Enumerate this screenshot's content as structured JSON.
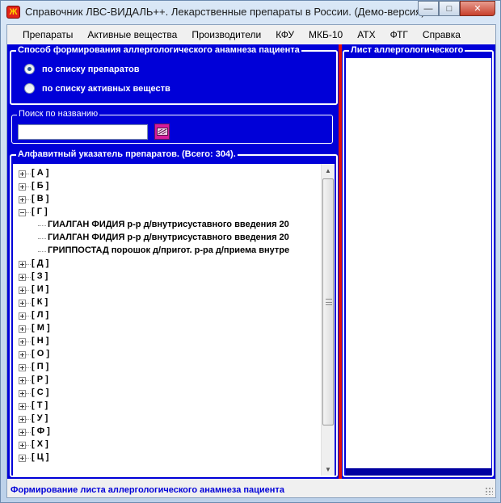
{
  "window": {
    "title": "Справочник ЛВС-ВИДАЛЬ++. Лекарственные препараты в России. (Демо-версия).",
    "app_icon": "vidal-logo-icon",
    "controls": [
      "minimize-icon",
      "maximize-icon",
      "close-icon"
    ]
  },
  "menu": {
    "items": [
      "Препараты",
      "Активные вещества",
      "Производители",
      "КФУ",
      "МКБ-10",
      "АТХ",
      "ФТГ",
      "Справка"
    ]
  },
  "mode_group": {
    "title": "Способ формирования аллергологического анамнеза пациента",
    "options": [
      {
        "label": "по списку препаратов",
        "checked": true
      },
      {
        "label": "по списку активных веществ",
        "checked": false
      }
    ]
  },
  "search": {
    "title": "Поиск по названию",
    "value": "",
    "button_icon": "find-icon"
  },
  "tree": {
    "title": "Алфавитный указатель препаратов. (Всего: 304).",
    "nodes": [
      {
        "label": "[ А ]",
        "expanded": false
      },
      {
        "label": "[ Б ]",
        "expanded": false
      },
      {
        "label": "[ В ]",
        "expanded": false
      },
      {
        "label": "[ Г ]",
        "expanded": true,
        "children": [
          "ГИАЛГАН ФИДИЯ  р-р д/внутрисуставного введения 20",
          "ГИАЛГАН ФИДИЯ  р-р д/внутрисуставного введения 20",
          "ГРИППОСТАД   порошок д/пригот. р-ра д/приема внутре"
        ]
      },
      {
        "label": "[ Д ]",
        "expanded": false
      },
      {
        "label": "[ З ]",
        "expanded": false
      },
      {
        "label": "[ И ]",
        "expanded": false
      },
      {
        "label": "[ К ]",
        "expanded": false
      },
      {
        "label": "[ Л ]",
        "expanded": false
      },
      {
        "label": "[ М ]",
        "expanded": false
      },
      {
        "label": "[ Н ]",
        "expanded": false
      },
      {
        "label": "[ О ]",
        "expanded": false
      },
      {
        "label": "[ П ]",
        "expanded": false
      },
      {
        "label": "[ Р ]",
        "expanded": false
      },
      {
        "label": "[ С ]",
        "expanded": false
      },
      {
        "label": "[ Т ]",
        "expanded": false
      },
      {
        "label": "[ У ]",
        "expanded": false
      },
      {
        "label": "[ Ф ]",
        "expanded": false
      },
      {
        "label": "[ Х ]",
        "expanded": false
      },
      {
        "label": "[ Ц ]",
        "expanded": false
      }
    ]
  },
  "allergy_list": {
    "title": "Лист аллергологического"
  },
  "status": {
    "text": "Формирование листа аллергологического анамнеза пациента"
  },
  "colors": {
    "panel_blue": "#0000d8",
    "splitter_red": "#e01010",
    "status_text": "#0000d8"
  }
}
